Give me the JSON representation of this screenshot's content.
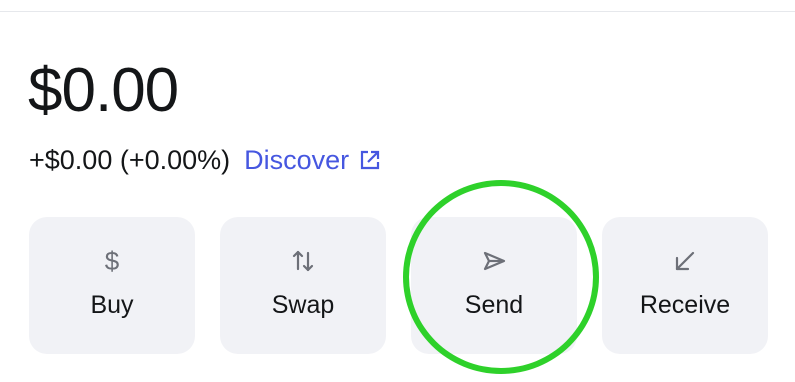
{
  "balance": {
    "amount": "$0.00",
    "change": "+$0.00 (+0.00%)"
  },
  "discover": {
    "label": "Discover",
    "icon": "external-link-icon",
    "color": "#4657e0"
  },
  "actions": [
    {
      "label": "Buy",
      "icon": "dollar-icon"
    },
    {
      "label": "Swap",
      "icon": "swap-arrows-icon"
    },
    {
      "label": "Send",
      "icon": "send-icon"
    },
    {
      "label": "Receive",
      "icon": "receive-arrow-icon"
    }
  ],
  "highlight": {
    "target": "Send",
    "color": "#2ed12a"
  }
}
